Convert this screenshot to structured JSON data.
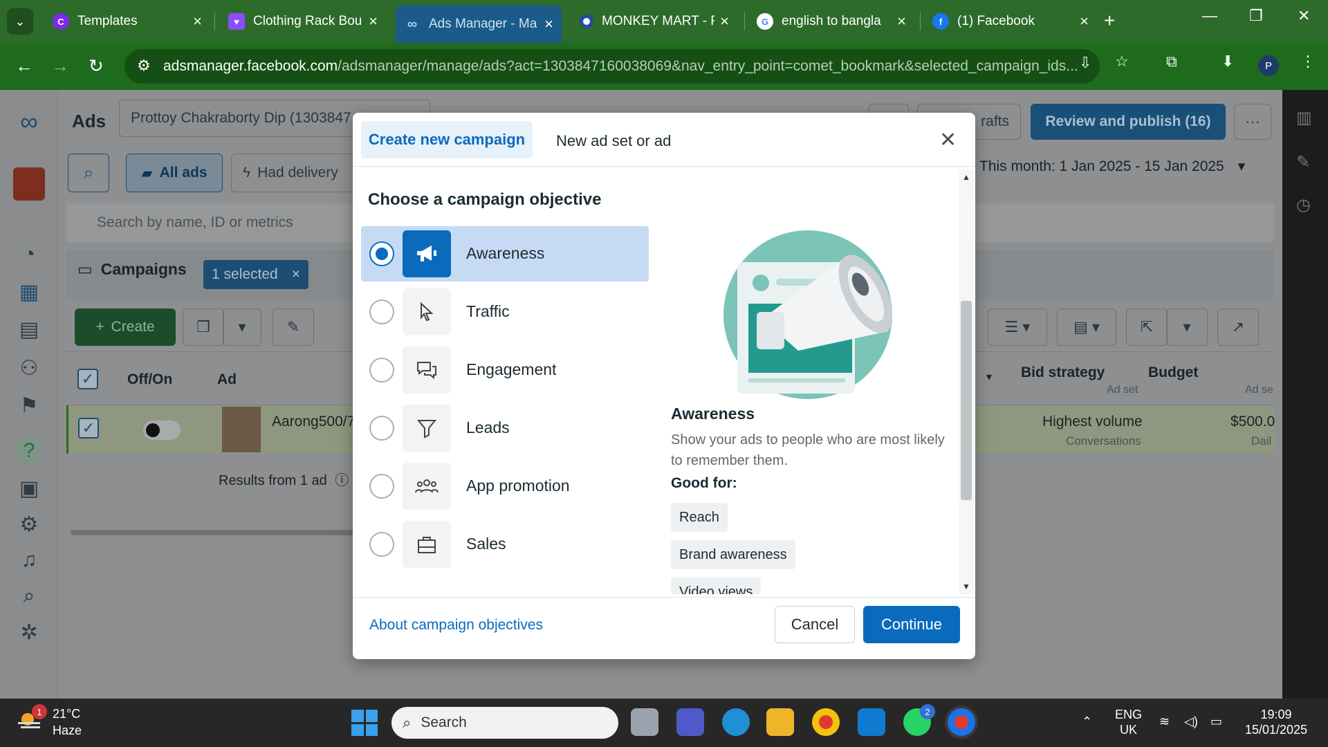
{
  "browser": {
    "tabs": [
      {
        "title": "Templates",
        "active": false,
        "favicon": "canva-icon",
        "color": "#7d2ae8"
      },
      {
        "title": "Clothing Rack Bou",
        "active": false,
        "favicon": "heart-icon",
        "color": "#8a4dff"
      },
      {
        "title": "Ads Manager - Ma",
        "active": true,
        "favicon": "meta-icon",
        "color": "#1a5b8a"
      },
      {
        "title": "MONKEY MART - F",
        "active": false,
        "favicon": "circle-icon",
        "color": "#ffffff"
      },
      {
        "title": "english to bangla",
        "active": false,
        "favicon": "google-icon",
        "color": "#ffffff"
      },
      {
        "title": "(1) Facebook",
        "active": false,
        "favicon": "facebook-icon",
        "color": "#1877f2"
      }
    ],
    "url_host": "adsmanager.facebook.com",
    "url_rest": "/adsmanager/manage/ads?act=1303847160038069&nav_entry_point=comet_bookmark&selected_campaign_ids...",
    "profile_initial": "P"
  },
  "page": {
    "ads_label": "Ads",
    "account": "Prottoy Chakraborty Dip (1303847",
    "drafts_label": "rafts",
    "review_button": "Review and publish (16)",
    "more": "···",
    "all_ads": "All ads",
    "had_delivery": "Had delivery",
    "date_range": "This month: 1 Jan 2025 - 15 Jan 2025",
    "search_placeholder": "Search by name, ID or metrics",
    "campaigns_tab": "Campaigns",
    "selected_chip": "1 selected",
    "create_button": "Create",
    "columns": {
      "offon": "Off/On",
      "ad": "Ad",
      "bid_strategy": "Bid strategy",
      "bid_sub": "Ad set",
      "budget": "Budget",
      "budget_sub": "Ad se"
    },
    "row": {
      "ad_name": "Aarong500/7",
      "bid": "Highest volume",
      "bid_sub": "Conversations",
      "budget": "$500.0",
      "budget_sub": "Dail"
    },
    "results": "Results from 1 ad"
  },
  "modal": {
    "tab_active": "Create new campaign",
    "tab_other": "New ad set or ad",
    "heading": "Choose a campaign objective",
    "options": [
      {
        "label": "Awareness",
        "icon": "megaphone-icon",
        "selected": true
      },
      {
        "label": "Traffic",
        "icon": "cursor-icon",
        "selected": false
      },
      {
        "label": "Engagement",
        "icon": "chat-bubbles-icon",
        "selected": false
      },
      {
        "label": "Leads",
        "icon": "funnel-icon",
        "selected": false
      },
      {
        "label": "App promotion",
        "icon": "people-icon",
        "selected": false
      },
      {
        "label": "Sales",
        "icon": "shopping-bag-icon",
        "selected": false
      }
    ],
    "detail": {
      "title": "Awareness",
      "description": "Show your ads to people who are most likely to remember them.",
      "good_for_label": "Good for:",
      "chips": [
        "Reach",
        "Brand awareness",
        "Video views"
      ]
    },
    "about_link": "About campaign objectives",
    "cancel": "Cancel",
    "continue": "Continue"
  },
  "taskbar": {
    "weather_temp": "21°C",
    "weather_desc": "Haze",
    "weather_badge": "1",
    "search_label": "Search",
    "whatsapp_badge": "2",
    "lang_top": "ENG",
    "lang_bottom": "UK",
    "time": "19:09",
    "date": "15/01/2025"
  }
}
